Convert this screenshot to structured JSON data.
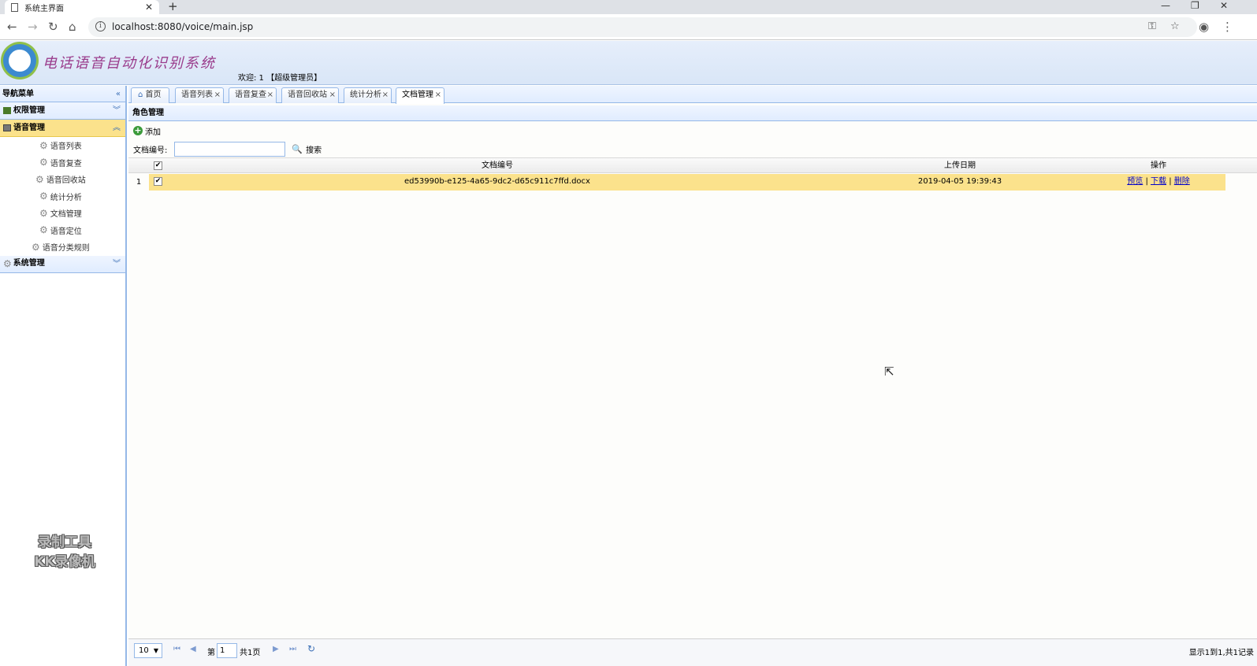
{
  "browser": {
    "tab_title": "系统主界面",
    "url": "localhost:8080/voice/main.jsp"
  },
  "app": {
    "title": "电话语音自动化识别系统",
    "welcome": "欢迎: 1 【超级管理员】"
  },
  "nav": {
    "title": "导航菜单",
    "groups": [
      {
        "label": "权限管理"
      },
      {
        "label": "语音管理"
      },
      {
        "label": "系统管理"
      }
    ],
    "sub_items": [
      "语音列表",
      "语音复查",
      "语音回收站",
      "统计分析",
      "文档管理",
      "语音定位",
      "语音分类规则"
    ]
  },
  "watermark": {
    "line1": "录制工具",
    "line2": "KK录像机"
  },
  "tabs": [
    {
      "label": "首页"
    },
    {
      "label": "语音列表"
    },
    {
      "label": "语音复查"
    },
    {
      "label": "语音回收站"
    },
    {
      "label": "统计分析"
    },
    {
      "label": "文档管理"
    }
  ],
  "panel": {
    "title": "角色管理",
    "add_label": "添加",
    "search_label": "文档编号:",
    "search_value": "",
    "search_button": "搜索"
  },
  "grid": {
    "columns": [
      "文档编号",
      "上传日期",
      "操作"
    ],
    "rows": [
      {
        "num": "1",
        "doc_id": "ed53990b-e125-4a65-9dc2-d65c911c7ffd.docx",
        "date": "2019-04-05 19:39:43",
        "actions": [
          "预览",
          "下载",
          "删除"
        ]
      }
    ]
  },
  "pager": {
    "page_size": "10",
    "page_prefix": "第",
    "page_value": "1",
    "page_suffix": "共1页",
    "summary": "显示1到1,共1记录"
  }
}
